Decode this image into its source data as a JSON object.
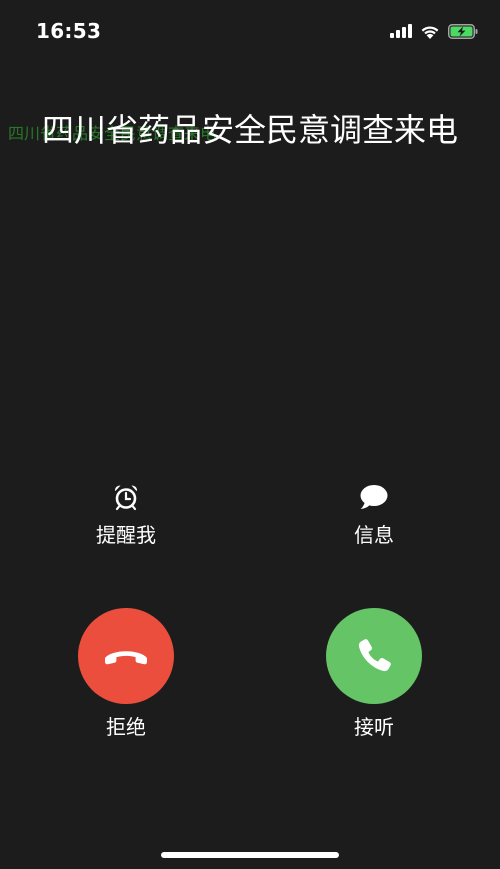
{
  "status_bar": {
    "time": "16:53",
    "icons": [
      "cellular-signal-icon",
      "wifi-icon",
      "battery-charging-icon"
    ]
  },
  "caller": {
    "name": "四川省药品安全民意调查来电",
    "ghost_text": "四川省药品安全民意调查来电"
  },
  "actions": {
    "remind": {
      "label": "提醒我",
      "icon": "alarm-clock-icon"
    },
    "message": {
      "label": "信息",
      "icon": "speech-bubble-icon"
    }
  },
  "call_buttons": {
    "decline": {
      "label": "拒绝",
      "icon": "phone-hangup-icon",
      "color": "#eb4e3d"
    },
    "accept": {
      "label": "接听",
      "icon": "phone-icon",
      "color": "#65c466"
    }
  },
  "colors": {
    "background": "#1c1c1c",
    "battery_fill": "#4cd964"
  }
}
